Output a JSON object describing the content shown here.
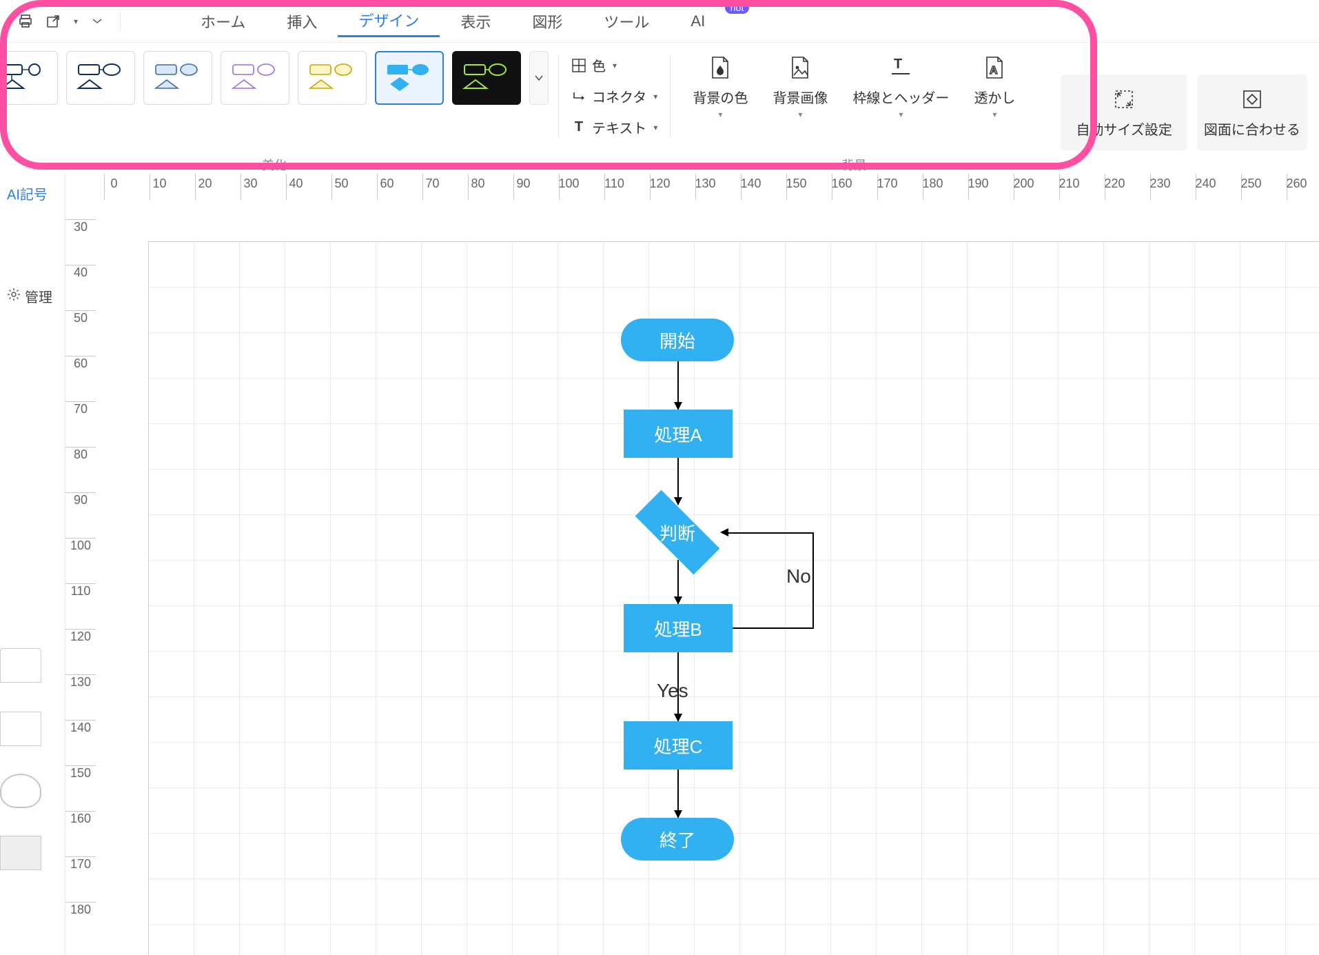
{
  "topbar": {
    "tabs": [
      {
        "label": "ホーム"
      },
      {
        "label": "挿入"
      },
      {
        "label": "デザイン",
        "active": true
      },
      {
        "label": "表示"
      },
      {
        "label": "図形"
      },
      {
        "label": "ツール"
      },
      {
        "label": "AI",
        "badge": "hot"
      }
    ]
  },
  "ribbon": {
    "group_labels": {
      "beautify": "美化",
      "background": "背景"
    },
    "stack": {
      "color": "色",
      "connector": "コネクタ",
      "text": "テキスト"
    },
    "big": {
      "bgcolor": "背景の色",
      "bgimage": "背景画像",
      "border_header": "枠線とヘッダー",
      "watermark": "透かし",
      "autosize": "自動サイズ設定",
      "fit_drawing": "図面に合わせる"
    }
  },
  "sidebar": {
    "ai_symbols": "AI記号",
    "manage": "管理"
  },
  "ruler": {
    "h": [
      "0",
      "10",
      "20",
      "30",
      "40",
      "50",
      "60",
      "70",
      "80",
      "90",
      "100",
      "110",
      "120",
      "130",
      "140",
      "150",
      "160",
      "170",
      "180",
      "190",
      "200",
      "210",
      "220",
      "230",
      "240",
      "250",
      "260"
    ],
    "v": [
      "30",
      "40",
      "50",
      "60",
      "70",
      "80",
      "90",
      "100",
      "110",
      "120",
      "130",
      "140",
      "150",
      "160",
      "170",
      "180"
    ]
  },
  "flowchart": {
    "start": "開始",
    "procA": "処理A",
    "decision": "判断",
    "procB": "処理B",
    "procC": "処理C",
    "end": "終了",
    "yes": "Yes",
    "no": "No"
  }
}
